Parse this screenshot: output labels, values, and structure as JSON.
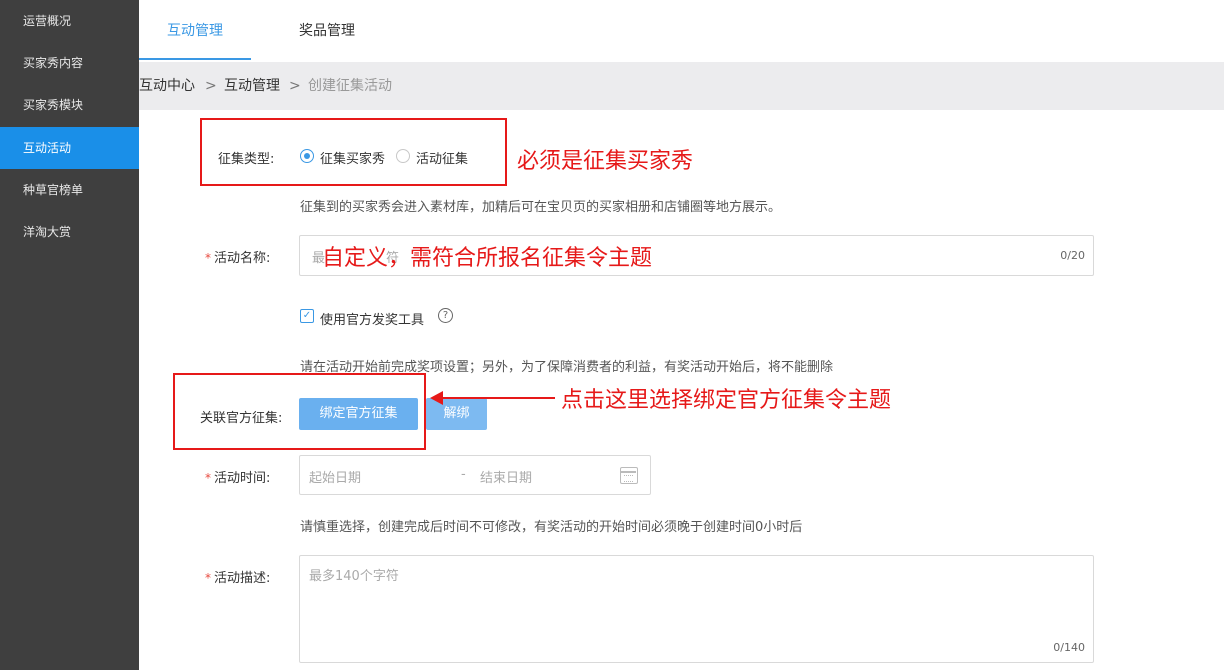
{
  "sidebar": {
    "items": [
      {
        "label": "运营概况"
      },
      {
        "label": "买家秀内容"
      },
      {
        "label": "买家秀模块"
      },
      {
        "label": "互动活动"
      },
      {
        "label": "种草官榜单"
      },
      {
        "label": "洋淘大赏"
      }
    ],
    "active_index": 3
  },
  "tabs": [
    {
      "label": "互动管理",
      "active": true
    },
    {
      "label": "奖品管理",
      "active": false
    }
  ],
  "breadcrumb": {
    "items": [
      "互动中心",
      "互动管理",
      "创建征集活动"
    ],
    "separator": ">"
  },
  "form": {
    "collect_type": {
      "label": "征集类型:",
      "options": [
        {
          "label": "征集买家秀",
          "selected": true
        },
        {
          "label": "活动征集",
          "selected": false
        }
      ],
      "hint": "征集到的买家秀会进入素材库，加精后可在宝贝页的买家相册和店铺圈等地方展示。"
    },
    "activity_name": {
      "required_mark": "*",
      "label": "活动名称:",
      "placeholder_visible": "最",
      "placeholder_tail": "符",
      "counter": "0/20"
    },
    "official_tool": {
      "checked": true,
      "check_glyph": "✓",
      "label": "使用官方发奖工具",
      "help_glyph": "?",
      "hint": "请在活动开始前完成奖项设置；另外，为了保障消费者的利益，有奖活动开始后，将不能删除"
    },
    "related_official": {
      "label": "关联官方征集:",
      "bind_button": "绑定官方征集",
      "unbind_button": "解绑"
    },
    "activity_time": {
      "required_mark": "*",
      "label": "活动时间:",
      "start_placeholder": "起始日期",
      "separator": "-",
      "end_placeholder": "结束日期",
      "hint": "请慎重选择，创建完成后时间不可修改，有奖活动的开始时间必须晚于创建时间0小时后"
    },
    "activity_desc": {
      "required_mark": "*",
      "label": "活动描述:",
      "placeholder": "最多140个字符",
      "counter": "0/140"
    }
  },
  "annotations": {
    "type_note": "必须是征集买家秀",
    "name_note": "自定义，需符合所报名征集令主题",
    "bind_note": "点击这里选择绑定官方征集令主题"
  },
  "colors": {
    "sidebar_bg": "#3f3f3f",
    "sidebar_active": "#1a8fe8",
    "accent": "#3a98e4",
    "annotation_red": "#e61919",
    "primary_button": "#6ab0ef"
  }
}
